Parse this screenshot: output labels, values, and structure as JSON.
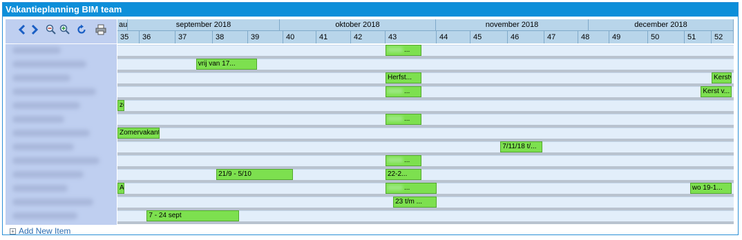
{
  "window": {
    "title": "Vakantieplanning BIM team"
  },
  "toolbar": {
    "buttons": [
      {
        "name": "prev-icon",
        "label": "<"
      },
      {
        "name": "next-icon",
        "label": ">"
      },
      {
        "name": "zoom-out-icon",
        "label": "zoom-out"
      },
      {
        "name": "zoom-in-icon",
        "label": "zoom-in"
      },
      {
        "name": "refresh-icon",
        "label": "refresh"
      },
      {
        "name": "print-icon",
        "label": "print"
      }
    ]
  },
  "timeline": {
    "months": [
      "au",
      "september 2018",
      "oktober 2018",
      "november 2018",
      "december 2018"
    ],
    "weeks": [
      "35",
      "36",
      "37",
      "38",
      "39",
      "40",
      "41",
      "42",
      "43",
      "44",
      "45",
      "46",
      "47",
      "48",
      "49",
      "50",
      "51",
      "52"
    ]
  },
  "rows": [
    {
      "bars": [
        {
          "week_start": 43,
          "week_span": 0.7,
          "label": "..."
        }
      ]
    },
    {
      "bars": [
        {
          "week_start": 37.55,
          "week_span": 1.7,
          "label": "vrij van 17..."
        }
      ]
    },
    {
      "bars": [
        {
          "week_start": 43,
          "week_span": 0.7,
          "label": "Herfst..."
        },
        {
          "week_start": 52,
          "week_span": 0.9,
          "label": "Kerstva..."
        }
      ]
    },
    {
      "bars": [
        {
          "week_start": 43,
          "week_span": 0.7,
          "label": "..."
        },
        {
          "week_start": 51.6,
          "week_span": 1.3,
          "label": "Kerst v..."
        }
      ]
    },
    {
      "bars": [
        {
          "week_start": 35,
          "week_span": 0.3,
          "label": "zo"
        }
      ]
    },
    {
      "bars": [
        {
          "week_start": 43,
          "week_span": 0.7,
          "label": "..."
        }
      ]
    },
    {
      "bars": [
        {
          "week_start": 35,
          "week_span": 1.55,
          "label": "Zomervakantie"
        }
      ]
    },
    {
      "bars": [
        {
          "week_start": 45.8,
          "week_span": 1.15,
          "label": "7/11/18 t/..."
        }
      ]
    },
    {
      "bars": [
        {
          "week_start": 43,
          "week_span": 0.7,
          "label": "..."
        }
      ]
    },
    {
      "bars": [
        {
          "week_start": 38.1,
          "week_span": 2.2,
          "label": "21/9 - 5/10"
        },
        {
          "week_start": 43,
          "week_span": 0.7,
          "label": "22-2..."
        }
      ]
    },
    {
      "bars": [
        {
          "week_start": 35,
          "week_span": 0.3,
          "label": "Alt"
        },
        {
          "week_start": 43,
          "week_span": 1.0,
          "label": "..."
        },
        {
          "week_start": 51.2,
          "week_span": 1.7,
          "label": "wo 19-1..."
        }
      ]
    },
    {
      "bars": [
        {
          "week_start": 43.15,
          "week_span": 0.85,
          "label": "23 t/m ..."
        }
      ]
    },
    {
      "bars": [
        {
          "week_start": 36.2,
          "week_span": 2.55,
          "label": "7 - 24 sept"
        }
      ]
    }
  ],
  "footer": {
    "add_new_label": "Add New Item"
  },
  "colors": {
    "title_bg": "#0d8fd9",
    "bar_fill": "#7de04f",
    "row_bg": "#e2eefa",
    "header_bg": "#b8d5ea"
  }
}
